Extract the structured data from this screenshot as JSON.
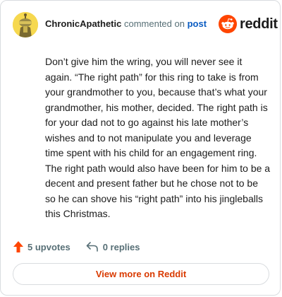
{
  "header": {
    "username": "ChronicApathetic",
    "action_text": "commented on",
    "post_link": "post",
    "brand": "reddit"
  },
  "comment": {
    "body": "Don’t give him the wring, you will never see it again. “The right path” for this ring to take is from your grandmother to you, because that’s what your grandmother, his mother, decided. The right path is for your dad not to go against his late mother’s wishes and to not manipulate you and leverage time spent with his child for an engagement ring. The right path would also have been for him to be a decent and present father but he chose not to be so he can shove his “right path” into his jingleballs this Christmas."
  },
  "footer": {
    "upvotes_label": "5 upvotes",
    "replies_label": "0 replies"
  },
  "actions": {
    "view_more_label": "View more on Reddit"
  },
  "colors": {
    "brand_orange": "#ff4500",
    "link_blue": "#0a5cc2",
    "muted": "#576f76",
    "view_more_text": "#d93a00",
    "avatar_bg": "#f6d84f"
  },
  "icons": {
    "avatar": "snoo-avatar",
    "logo": "reddit-snoo-icon",
    "upvote": "upvote-arrow-icon",
    "reply": "reply-arrow-icon"
  }
}
